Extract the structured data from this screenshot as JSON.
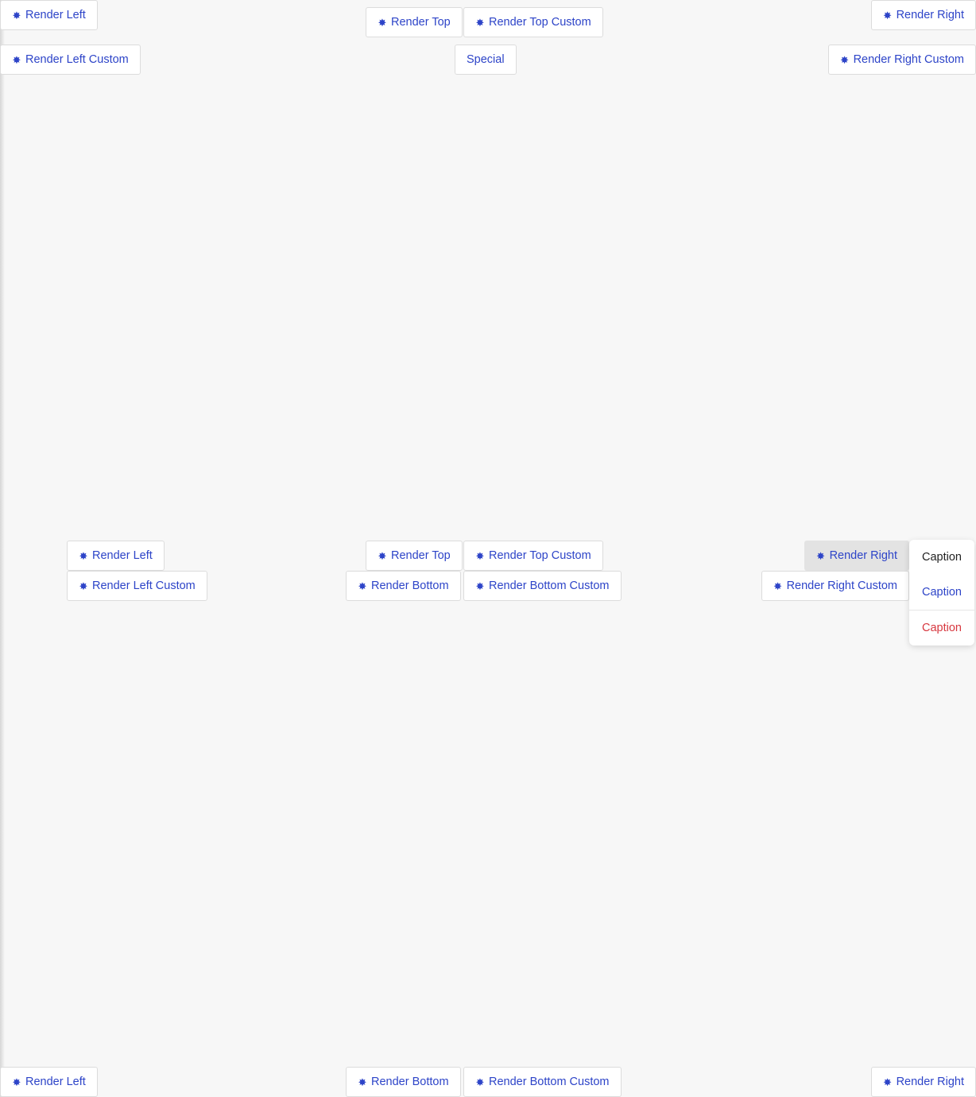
{
  "colors": {
    "background": "#f7f7f7",
    "link": "#2d44c8",
    "danger": "#d7373f",
    "button_active": "#e3e3e3"
  },
  "icon": {
    "name": "asterisk-icon",
    "glyph": "✸"
  },
  "buttons": {
    "render_left": "Render Left",
    "render_left_custom": "Render Left Custom",
    "render_top": "Render Top",
    "render_top_custom": "Render Top Custom",
    "render_right": "Render Right",
    "render_right_custom": "Render Right Custom",
    "render_bottom": "Render Bottom",
    "render_bottom_custom": "Render Bottom Custom",
    "special": "Special"
  },
  "dropdown": {
    "items": [
      {
        "label": "Caption",
        "style": "plain"
      },
      {
        "label": "Caption",
        "style": "primary"
      },
      {
        "label": "Caption",
        "style": "danger"
      }
    ]
  }
}
